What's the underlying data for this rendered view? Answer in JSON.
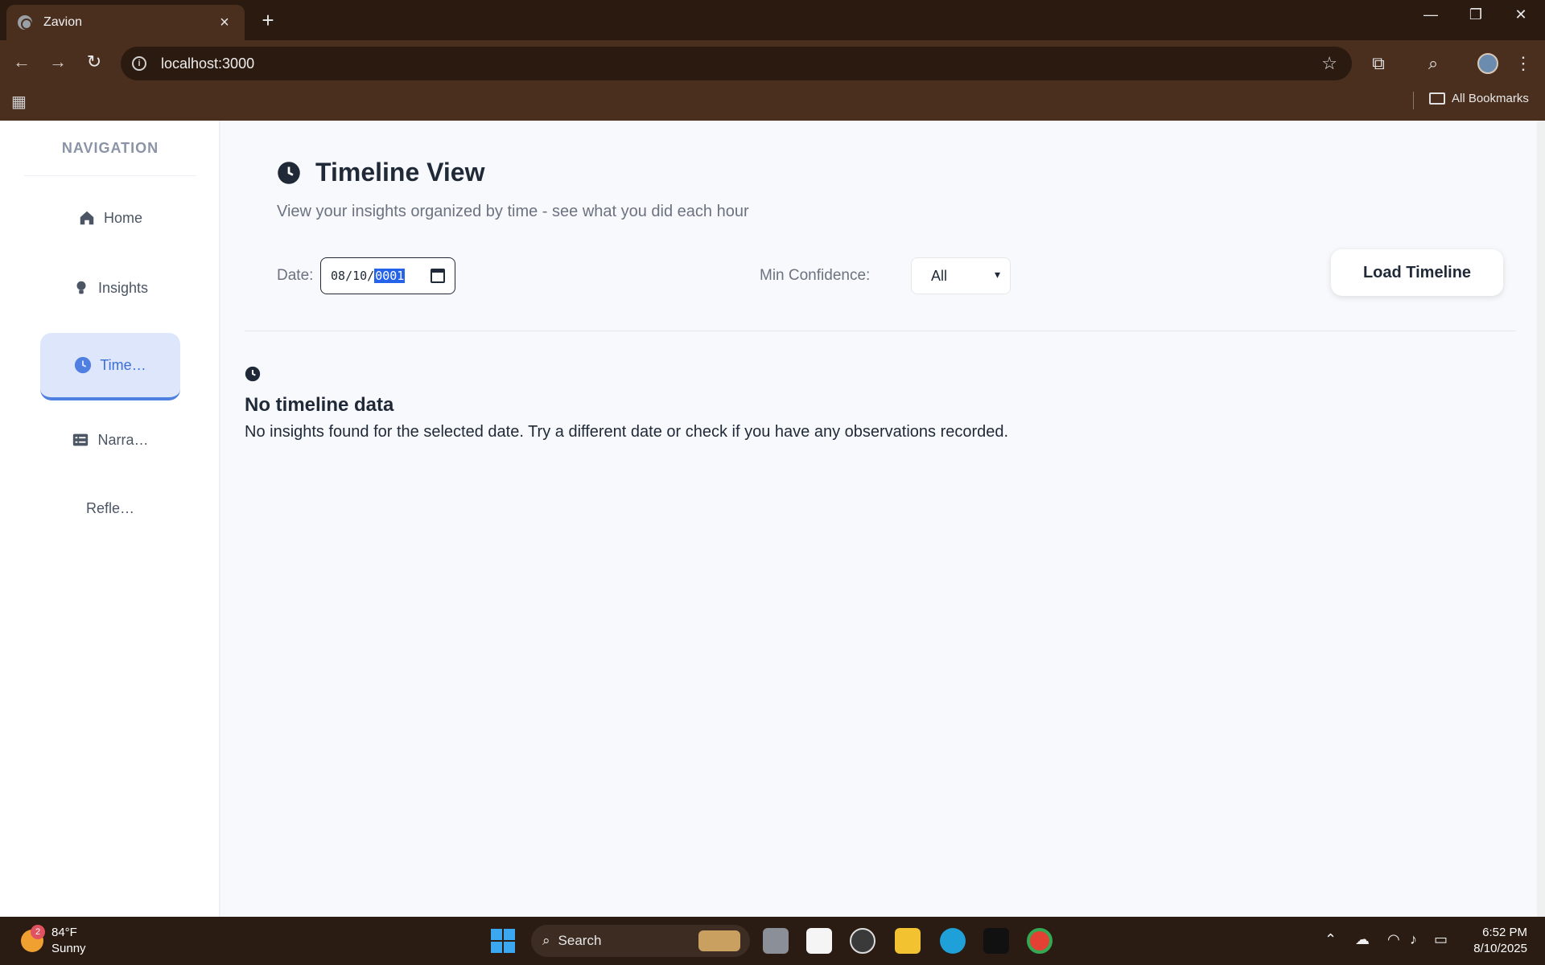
{
  "browser": {
    "tab_title": "Zavion",
    "url": "localhost:3000",
    "bookmarks_label": "All Bookmarks"
  },
  "sidebar": {
    "heading": "NAVIGATION",
    "items": [
      {
        "label": "Home",
        "icon": "home-icon"
      },
      {
        "label": "Insights",
        "icon": "lightbulb-icon"
      },
      {
        "label": "Time…",
        "icon": "clock-icon",
        "active": true
      },
      {
        "label": "Narra…",
        "icon": "list-icon"
      },
      {
        "label": "Refle…",
        "icon": ""
      }
    ]
  },
  "main": {
    "title": "Timeline View",
    "subtitle": "View your insights organized by time - see what you did each hour",
    "date_label": "Date:",
    "date_value": {
      "month": "08",
      "day": "10",
      "year": "0001"
    },
    "confidence_label": "Min Confidence:",
    "confidence_value": "All",
    "load_button": "Load Timeline",
    "empty_title": "No timeline data",
    "empty_text": "No insights found for the selected date. Try a different date or check if you have any observations recorded."
  },
  "taskbar": {
    "weather_temp": "84°F",
    "weather_desc": "Sunny",
    "weather_badge": "2",
    "search_label": "Search",
    "time": "6:52 PM",
    "date": "8/10/2025"
  },
  "colors": {
    "accent": "#4f7fe0",
    "active_bg": "#dde6fb",
    "chrome_bg": "#4a2f1f"
  }
}
